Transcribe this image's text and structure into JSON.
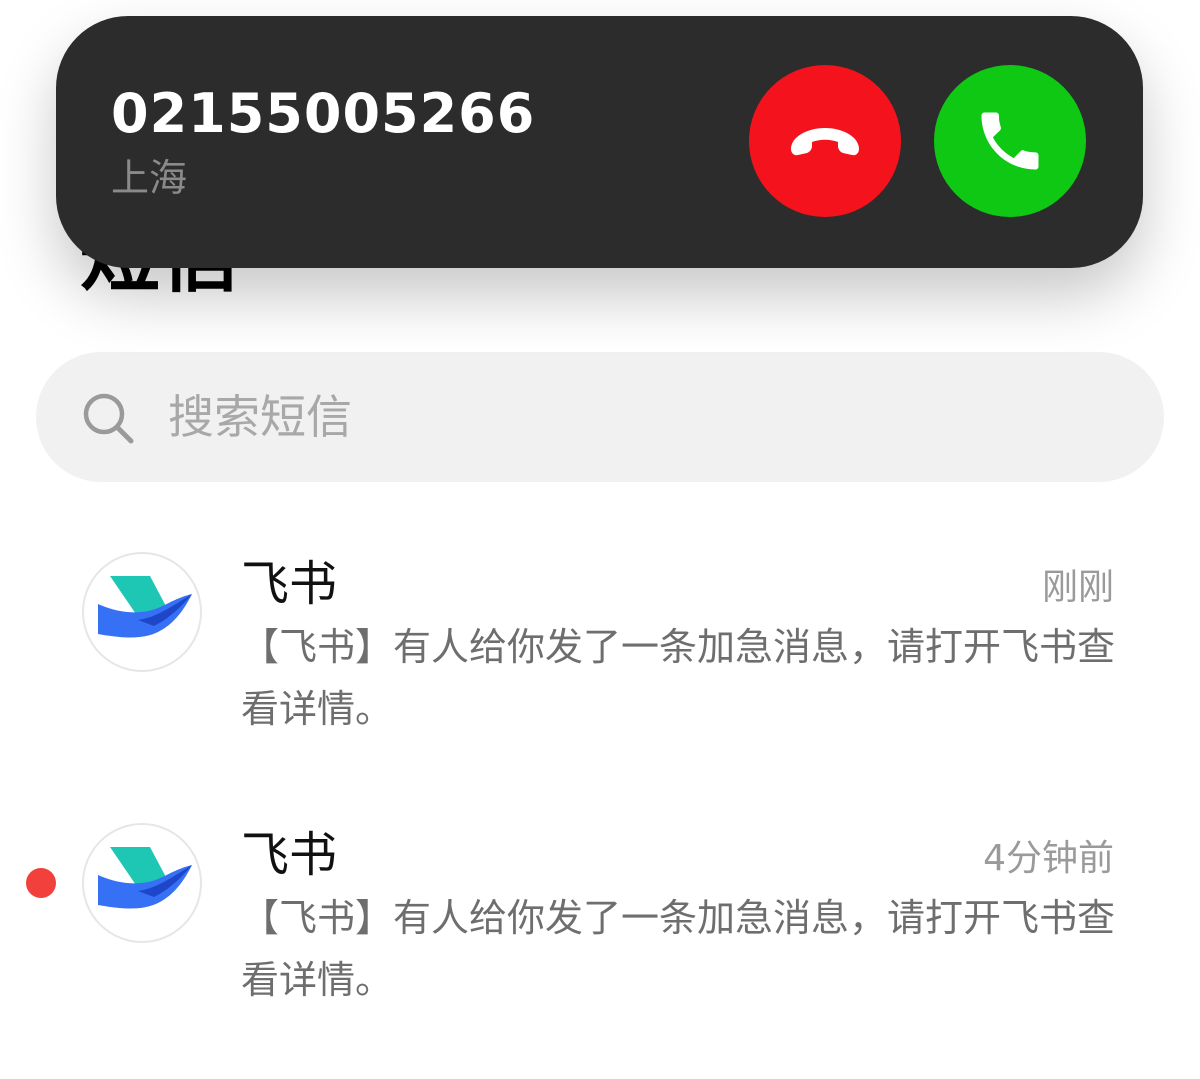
{
  "call": {
    "number": "02155005266",
    "location": "上海",
    "decline_color": "#f4131c",
    "accept_color": "#0ec814"
  },
  "page": {
    "title": "短信"
  },
  "search": {
    "placeholder": "搜索短信",
    "value": ""
  },
  "messages": [
    {
      "sender": "飞书",
      "time": "刚刚",
      "preview": "【飞书】有人给你发了一条加急消息，请打开飞书查看详情。",
      "unread": false,
      "icon": "feishu-logo-icon"
    },
    {
      "sender": "飞书",
      "time": "4分钟前",
      "preview": "【飞书】有人给你发了一条加急消息，请打开飞书查看详情。",
      "unread": true,
      "icon": "feishu-logo-icon"
    }
  ]
}
